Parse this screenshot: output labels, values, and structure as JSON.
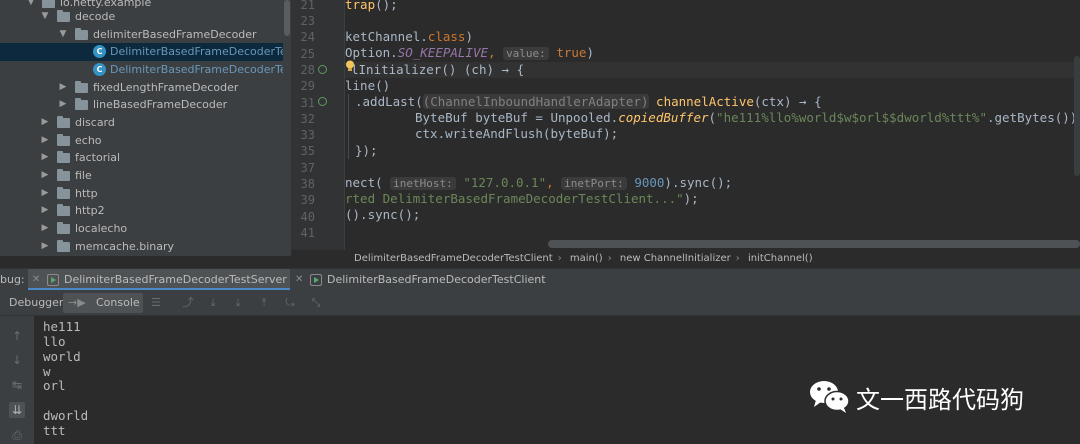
{
  "project_tree": {
    "items": [
      {
        "label": "io.netty.example",
        "kind": "folder"
      },
      {
        "label": "decode",
        "kind": "folder"
      },
      {
        "label": "delimiterBasedFrameDecoder",
        "kind": "folder"
      },
      {
        "label": "DelimiterBasedFrameDecoderTes",
        "kind": "class"
      },
      {
        "label": "DelimiterBasedFrameDecoderTes",
        "kind": "class"
      },
      {
        "label": "fixedLengthFrameDecoder",
        "kind": "folder"
      },
      {
        "label": "lineBasedFrameDecoder",
        "kind": "folder"
      },
      {
        "label": "discard",
        "kind": "folder"
      },
      {
        "label": "echo",
        "kind": "folder"
      },
      {
        "label": "factorial",
        "kind": "folder"
      },
      {
        "label": "file",
        "kind": "folder"
      },
      {
        "label": "http",
        "kind": "folder"
      },
      {
        "label": "http2",
        "kind": "folder"
      },
      {
        "label": "localecho",
        "kind": "folder"
      },
      {
        "label": "memcache.binary",
        "kind": "folder"
      }
    ]
  },
  "editor": {
    "line_numbers": [
      "21",
      "23",
      "24",
      "25",
      "28",
      "29",
      "31",
      "32",
      "33",
      "35",
      "37",
      "38",
      "39",
      "40",
      "41"
    ],
    "lines": {
      "l21": {
        "a": "trap",
        "b": "();"
      },
      "l23": {
        "a": "ketChannel.",
        "b": "class",
        "c": ")"
      },
      "l24": {
        "a": "Option.",
        "b": "SO_KEEPALIVE",
        "c": ",",
        "hint": "value:",
        "d": "true",
        "e": ")"
      },
      "l25": {
        "a": "lInitializer",
        "b": "() (ch) → {"
      },
      "l28": {
        "a": "line()"
      },
      "l29": {
        "a": ".addLast(",
        "fold": "(ChannelInboundHandlerAdapter)",
        "b": " channelActive",
        "c": "(ctx) → {"
      },
      "l31": {
        "a": "ByteBuf byteBuf = Unpooled.",
        "b": "copiedBuffer",
        "c": "(",
        "d": "\"he111%llo%world$w$orl$$dworld%ttt%\"",
        "e": ".getBytes());"
      },
      "l32": {
        "a": "ctx.writeAndFlush(byteBuf);"
      },
      "l33": {
        "a": "});"
      },
      "l37": {
        "a": "nect(",
        "hint1": "inetHost:",
        "b": "\"127.0.0.1\"",
        "c": ",",
        "hint2": "inetPort:",
        "d": "9000",
        "e": ").sync();"
      },
      "l38": {
        "a": "rted DelimiterBasedFrameDecoderTestClient...\"",
        "b": ");"
      },
      "l39": {
        "a": "().sync();"
      }
    }
  },
  "breadcrumb": [
    "DelimiterBasedFrameDecoderTestClient",
    "main()",
    "new ChannelInitializer",
    "initChannel()"
  ],
  "debug_bar": {
    "label": "bug:",
    "tabs": [
      "DelimiterBasedFrameDecoderTestServer",
      "DelimiterBasedFrameDecoderTestClient"
    ]
  },
  "debugger_toolbar": {
    "debugger_label": "Debugger",
    "console_label": "Console"
  },
  "console": {
    "lines": [
      "he111",
      "llo",
      "world",
      "w",
      "orl",
      "",
      "dworld",
      "ttt"
    ]
  },
  "watermark": {
    "text": "文一西路代码狗"
  }
}
